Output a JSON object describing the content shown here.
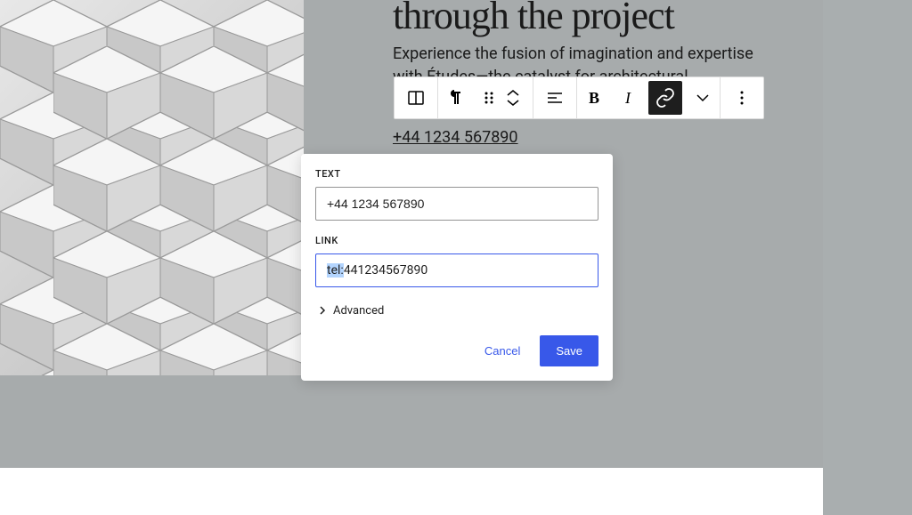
{
  "heading": "through the project",
  "paragraph": "Experience the fusion of imagination and expertise with Études—the catalyst for architectural",
  "phone_display": "+44 1234 567890",
  "toolbar": {
    "bold": "B",
    "italic": "I"
  },
  "popover": {
    "text_label": "TEXT",
    "text_value": "+44 1234 567890",
    "link_label": "LINK",
    "link_prefix": "tel:",
    "link_value": "441234567890",
    "advanced": "Advanced",
    "cancel": "Cancel",
    "save": "Save"
  }
}
